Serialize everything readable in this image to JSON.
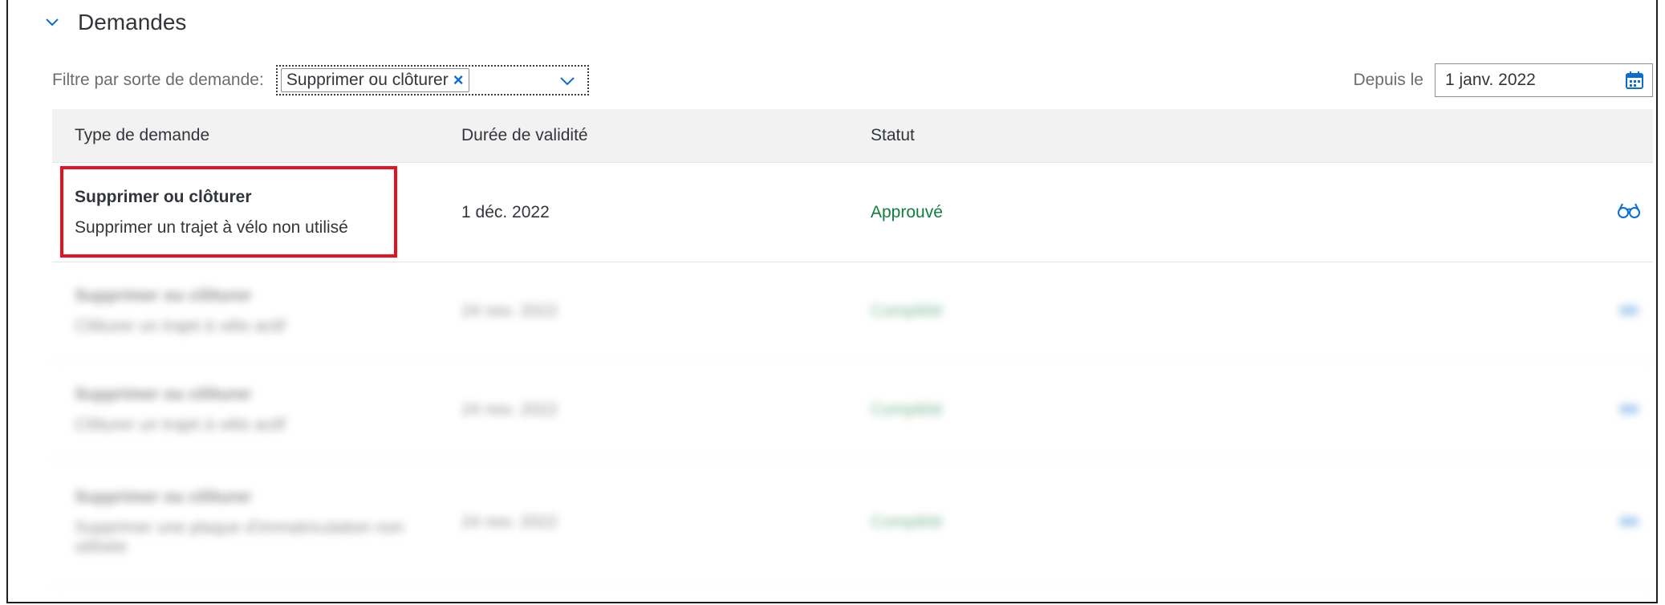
{
  "section": {
    "title": "Demandes"
  },
  "filter": {
    "label": "Filtre par sorte de demande:",
    "token": "Supprimer ou clôturer",
    "token_remove": "×",
    "date_label": "Depuis le",
    "date_value": "1 janv. 2022"
  },
  "table": {
    "columns": [
      "Type de demande",
      "Durée de validité",
      "Statut"
    ],
    "rows": [
      {
        "title": "Supprimer ou clôturer",
        "description": "Supprimer un trajet à vélo non utilisé",
        "validity": "1 déc. 2022",
        "status": "Approuvé",
        "action_icon": "glasses-icon",
        "highlighted": true
      },
      {
        "title": "Supprimer ou clôturer",
        "description": "Clôturer un trajet à vélo actif",
        "validity": "24 nov. 2022",
        "status": "Complété",
        "blurred": true
      },
      {
        "title": "Supprimer ou clôturer",
        "description": "Clôturer un trajet à vélo actif",
        "validity": "24 nov. 2022",
        "status": "Complété",
        "blurred": true
      },
      {
        "title": "Supprimer ou clôturer",
        "description": "Supprimer une plaque d'immatriculation non utilisée",
        "validity": "24 nov. 2022",
        "status": "Complété",
        "blurred": true
      }
    ]
  },
  "colors": {
    "accent": "#0a6ed1",
    "success": "#107e3e",
    "highlight": "#e8121f"
  }
}
